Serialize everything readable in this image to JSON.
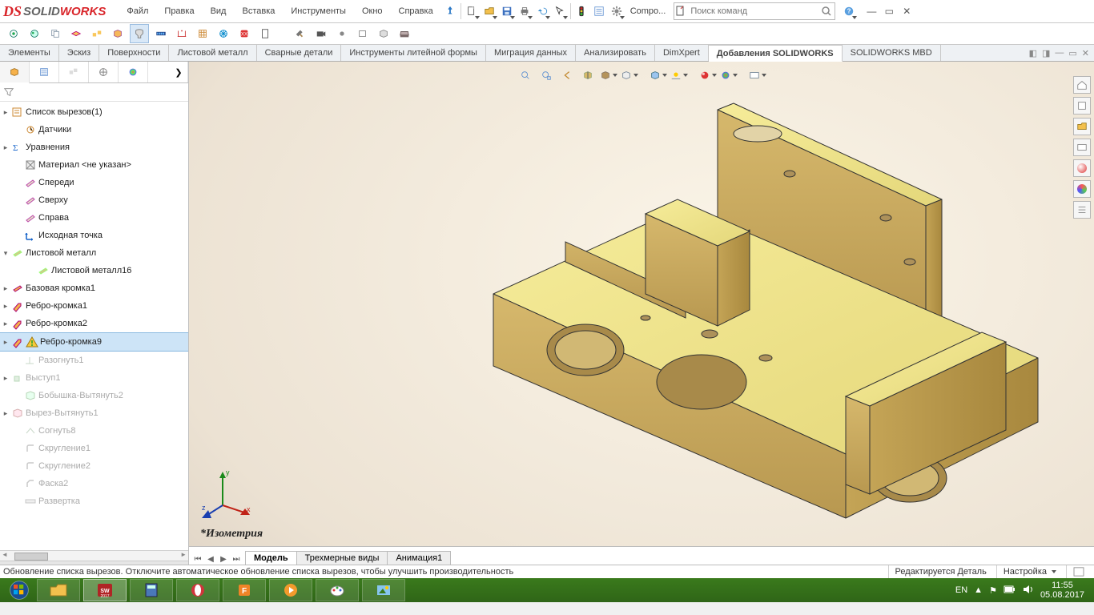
{
  "app": {
    "brand_solid": "SOLID",
    "brand_works": "WORKS",
    "search_placeholder": "Поиск команд",
    "compo_label": "Compo..."
  },
  "menu": [
    "Файл",
    "Правка",
    "Вид",
    "Вставка",
    "Инструменты",
    "Окно",
    "Справка"
  ],
  "cmdtabs": [
    "Элементы",
    "Эскиз",
    "Поверхности",
    "Листовой металл",
    "Сварные детали",
    "Инструменты литейной формы",
    "Миграция данных",
    "Анализировать",
    "DimXpert",
    "Добавления SOLIDWORKS",
    "SOLIDWORKS MBD"
  ],
  "cmdtab_active": 9,
  "tree": [
    {
      "expander": "▸",
      "indent": 0,
      "icon": "cutlist",
      "label": "Список вырезов(1)"
    },
    {
      "expander": "",
      "indent": 1,
      "icon": "sensor",
      "label": "Датчики"
    },
    {
      "expander": "▸",
      "indent": 0,
      "icon": "equation",
      "label": "Уравнения"
    },
    {
      "expander": "",
      "indent": 1,
      "icon": "material",
      "label": "Материал <не указан>"
    },
    {
      "expander": "",
      "indent": 1,
      "icon": "plane",
      "label": "Спереди"
    },
    {
      "expander": "",
      "indent": 1,
      "icon": "plane",
      "label": "Сверху"
    },
    {
      "expander": "",
      "indent": 1,
      "icon": "plane",
      "label": "Справа"
    },
    {
      "expander": "",
      "indent": 1,
      "icon": "origin",
      "label": "Исходная точка"
    },
    {
      "expander": "▾",
      "indent": 0,
      "icon": "sheetmetal",
      "label": "Листовой металл"
    },
    {
      "expander": "",
      "indent": 2,
      "icon": "sheetmetal",
      "label": "Листовой металл16"
    },
    {
      "expander": "▸",
      "indent": 0,
      "icon": "baseflange",
      "label": "Базовая кромка1"
    },
    {
      "expander": "▸",
      "indent": 0,
      "icon": "edgeflange",
      "label": "Ребро-кромка1"
    },
    {
      "expander": "▸",
      "indent": 0,
      "icon": "edgeflange",
      "label": "Ребро-кромка2"
    },
    {
      "expander": "▸",
      "indent": 0,
      "icon": "edgeflange",
      "label": "Ребро-кромка9",
      "warn": true,
      "selected": true
    },
    {
      "expander": "",
      "indent": 1,
      "icon": "unfold",
      "label": "Разогнуть1",
      "disabled": true
    },
    {
      "expander": "▸",
      "indent": 0,
      "icon": "boss",
      "label": "Выступ1",
      "disabled": true
    },
    {
      "expander": "",
      "indent": 1,
      "icon": "extrude",
      "label": "Бобышка-Вытянуть2",
      "disabled": true
    },
    {
      "expander": "▸",
      "indent": 0,
      "icon": "cut",
      "label": "Вырез-Вытянуть1",
      "disabled": true
    },
    {
      "expander": "",
      "indent": 1,
      "icon": "fold",
      "label": "Согнуть8",
      "disabled": true
    },
    {
      "expander": "",
      "indent": 1,
      "icon": "fillet",
      "label": "Скругление1",
      "disabled": true
    },
    {
      "expander": "",
      "indent": 1,
      "icon": "fillet",
      "label": "Скругление2",
      "disabled": true
    },
    {
      "expander": "",
      "indent": 1,
      "icon": "chamfer",
      "label": "Фаска2",
      "disabled": true
    },
    {
      "expander": "",
      "indent": 1,
      "icon": "flatten",
      "label": "Развертка",
      "disabled": true
    }
  ],
  "viewport": {
    "name_label": "*Изометрия",
    "triad_x": "x",
    "triad_y": "y",
    "triad_z": "z"
  },
  "bottom_tabs": [
    "Модель",
    "Трехмерные виды",
    "Анимация1"
  ],
  "bottom_tab_active": 0,
  "status": {
    "message": "Обновление списка вырезов. Отключите автоматическое обновление списка вырезов, чтобы улучшить производительность",
    "mode": "Редактируется Деталь",
    "setting": "Настройка"
  },
  "taskbar": {
    "lang": "EN",
    "time": "11:55",
    "date": "05.08.2017"
  }
}
